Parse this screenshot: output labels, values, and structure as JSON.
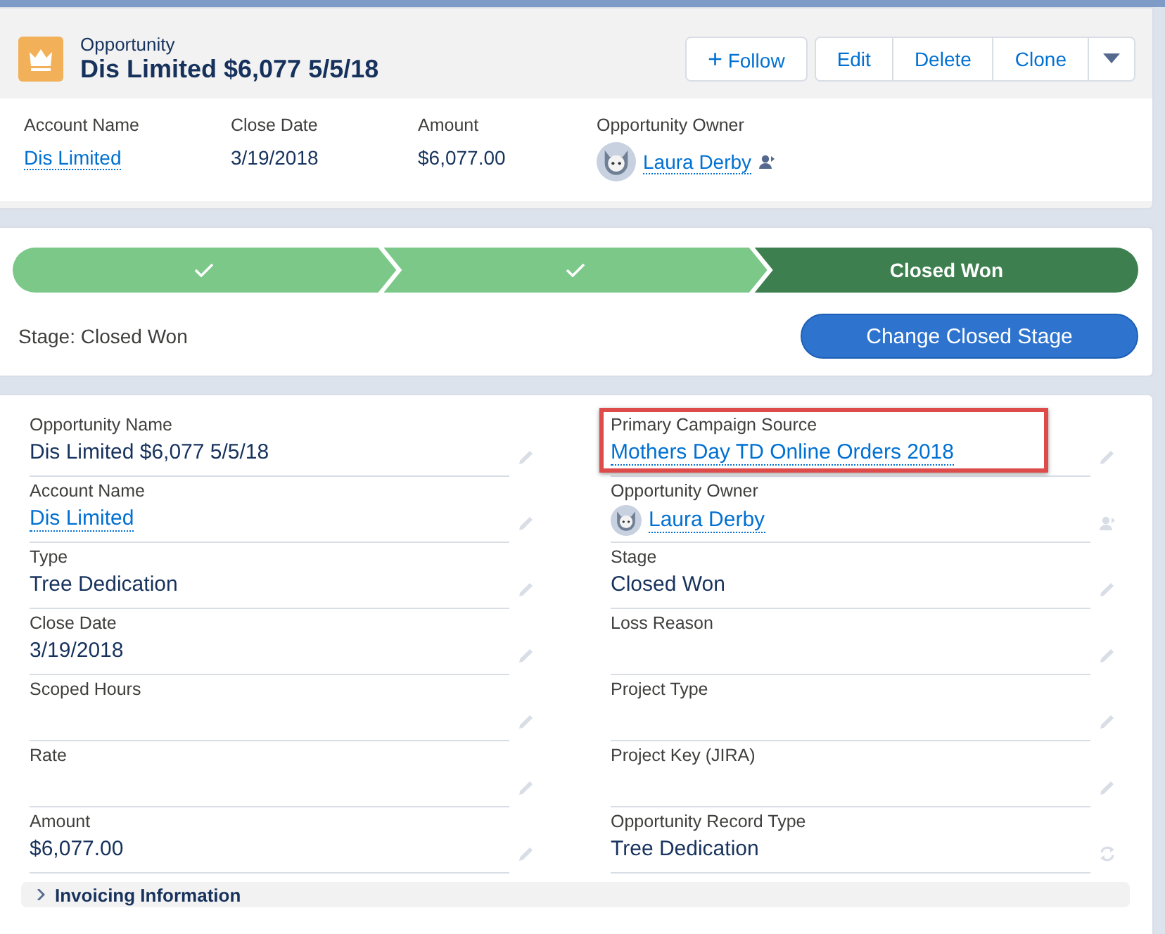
{
  "header": {
    "object_type": "Opportunity",
    "title": "Dis Limited $6,077 5/5/18",
    "follow_button": {
      "icon": "+",
      "label": "Follow"
    },
    "buttons": [
      "Edit",
      "Delete",
      "Clone"
    ]
  },
  "highlights": [
    {
      "label": "Account Name",
      "value": "Dis Limited",
      "kind": "link"
    },
    {
      "label": "Close Date",
      "value": "3/19/2018",
      "kind": "text"
    },
    {
      "label": "Amount",
      "value": "$6,077.00",
      "kind": "text"
    },
    {
      "label": "Opportunity Owner",
      "value": "Laura Derby",
      "kind": "owner"
    }
  ],
  "path": {
    "steps": [
      {
        "kind": "complete",
        "selected": false
      },
      {
        "kind": "complete",
        "selected": false
      },
      {
        "kind": "current",
        "label": "Closed Won",
        "selected": true
      }
    ],
    "stage_text": "Stage: Closed Won",
    "action_button": "Change Closed Stage"
  },
  "details": {
    "fields": [
      {
        "label": "Opportunity Name",
        "value": "Dis Limited $6,077 5/5/18",
        "kind": "text",
        "edit_icon": {
          "kind": "pencil"
        },
        "highlighted": false
      },
      {
        "label": "Primary Campaign Source",
        "value": "Mothers Day TD Online Orders 2018",
        "kind": "link",
        "edit_icon": {
          "kind": "pencil"
        },
        "highlighted": true
      },
      {
        "label": "Account Name",
        "value": "Dis Limited",
        "kind": "link",
        "edit_icon": {
          "kind": "pencil"
        },
        "highlighted": false
      },
      {
        "label": "Opportunity Owner",
        "value": "Laura Derby",
        "kind": "owner",
        "edit_icon": {
          "kind": "owner"
        },
        "highlighted": false
      },
      {
        "label": "Type",
        "value": "Tree Dedication",
        "kind": "text",
        "edit_icon": {
          "kind": "pencil"
        },
        "highlighted": false
      },
      {
        "label": "Stage",
        "value": "Closed Won",
        "kind": "text",
        "edit_icon": {
          "kind": "pencil"
        },
        "highlighted": false
      },
      {
        "label": "Close Date",
        "value": "3/19/2018",
        "kind": "text",
        "edit_icon": {
          "kind": "pencil"
        },
        "highlighted": false
      },
      {
        "label": "Loss Reason",
        "kind": "empty",
        "edit_icon": {
          "kind": "pencil"
        },
        "highlighted": false
      },
      {
        "label": "Scoped Hours",
        "kind": "empty",
        "edit_icon": {
          "kind": "pencil"
        },
        "highlighted": false
      },
      {
        "label": "Project Type",
        "kind": "empty",
        "edit_icon": {
          "kind": "pencil"
        },
        "highlighted": false
      },
      {
        "label": "Rate",
        "kind": "empty",
        "edit_icon": {
          "kind": "pencil"
        },
        "highlighted": false
      },
      {
        "label": "Project Key (JIRA)",
        "kind": "empty",
        "edit_icon": {
          "kind": "pencil"
        },
        "highlighted": false
      },
      {
        "label": "Amount",
        "value": "$6,077.00",
        "kind": "text",
        "edit_icon": {
          "kind": "pencil"
        },
        "highlighted": false
      },
      {
        "label": "Opportunity Record Type",
        "value": "Tree Dedication",
        "kind": "text",
        "edit_icon": {
          "kind": "recordtype"
        },
        "highlighted": false
      }
    ],
    "next_section": "Invoicing Information"
  }
}
